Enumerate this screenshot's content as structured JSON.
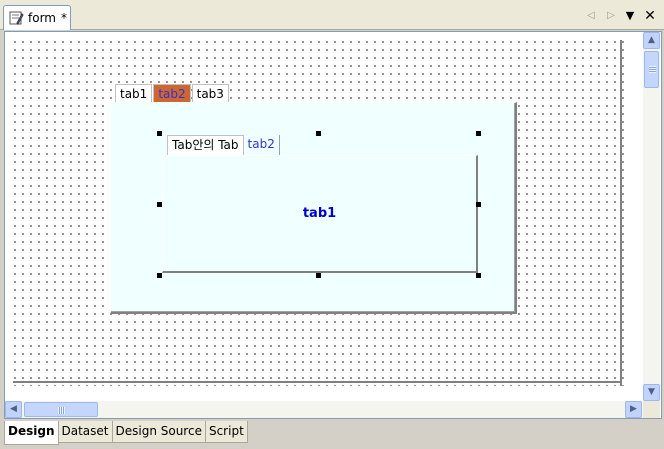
{
  "window": {
    "tab_label": "form",
    "modified_marker": "*"
  },
  "icons": {
    "file": "form-file-icon",
    "nav_left": "chevron-left-icon",
    "nav_right": "chevron-right-icon",
    "menu": "dropdown-menu-icon",
    "close": "close-icon"
  },
  "canvas": {
    "outer_tabs": [
      {
        "label": "tab1",
        "active": false
      },
      {
        "label": "tab2",
        "active": true
      },
      {
        "label": "tab3",
        "active": false
      }
    ],
    "inner_tabs": [
      {
        "label": "Tab안의 Tab",
        "active": true
      },
      {
        "label": "tab2",
        "active": false
      }
    ],
    "inner_content": "tab1"
  },
  "bottom_tabs": [
    {
      "label": "Design",
      "active": true
    },
    {
      "label": "Dataset",
      "active": false
    },
    {
      "label": "Design Source",
      "active": false
    },
    {
      "label": "Script",
      "active": false
    }
  ],
  "colors": {
    "active_tab_bg": "#cc6633",
    "panel_bg": "#f0ffff",
    "link_blue": "#0000cc"
  }
}
